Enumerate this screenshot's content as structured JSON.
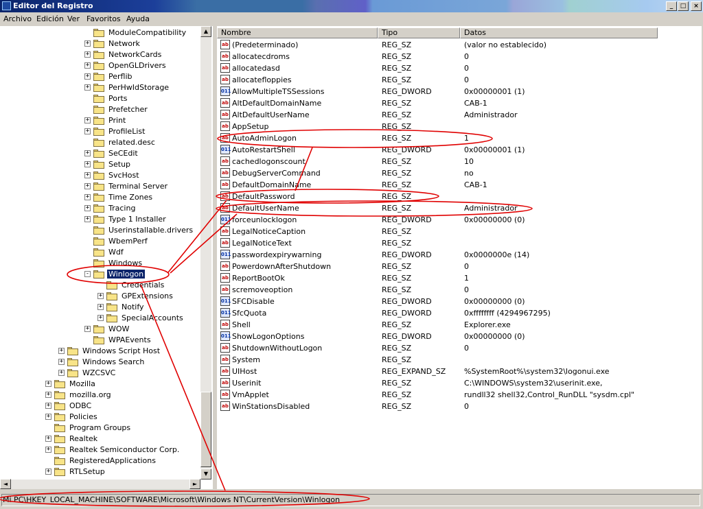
{
  "window": {
    "title": "Editor del Registro",
    "buttons": [
      "_",
      "□",
      "×"
    ]
  },
  "menu": [
    "Archivo",
    "Edición",
    "Ver",
    "Favoritos",
    "Ayuda"
  ],
  "tree": [
    {
      "label": "ModuleCompatibility",
      "level": 3,
      "exp": ""
    },
    {
      "label": "Network",
      "level": 3,
      "exp": "+"
    },
    {
      "label": "NetworkCards",
      "level": 3,
      "exp": "+"
    },
    {
      "label": "OpenGLDrivers",
      "level": 3,
      "exp": "+"
    },
    {
      "label": "Perflib",
      "level": 3,
      "exp": "+"
    },
    {
      "label": "PerHwIdStorage",
      "level": 3,
      "exp": "+"
    },
    {
      "label": "Ports",
      "level": 3,
      "exp": ""
    },
    {
      "label": "Prefetcher",
      "level": 3,
      "exp": ""
    },
    {
      "label": "Print",
      "level": 3,
      "exp": "+"
    },
    {
      "label": "ProfileList",
      "level": 3,
      "exp": "+"
    },
    {
      "label": "related.desc",
      "level": 3,
      "exp": ""
    },
    {
      "label": "SeCEdit",
      "level": 3,
      "exp": "+"
    },
    {
      "label": "Setup",
      "level": 3,
      "exp": "+"
    },
    {
      "label": "SvcHost",
      "level": 3,
      "exp": "+"
    },
    {
      "label": "Terminal Server",
      "level": 3,
      "exp": "+"
    },
    {
      "label": "Time Zones",
      "level": 3,
      "exp": "+"
    },
    {
      "label": "Tracing",
      "level": 3,
      "exp": "+"
    },
    {
      "label": "Type 1 Installer",
      "level": 3,
      "exp": "+"
    },
    {
      "label": "Userinstallable.drivers",
      "level": 3,
      "exp": ""
    },
    {
      "label": "WbemPerf",
      "level": 3,
      "exp": ""
    },
    {
      "label": "Wdf",
      "level": 3,
      "exp": ""
    },
    {
      "label": "Windows",
      "level": 3,
      "exp": ""
    },
    {
      "label": "Winlogon",
      "level": 3,
      "exp": "-",
      "selected": true
    },
    {
      "label": "Credentials",
      "level": 4,
      "exp": ""
    },
    {
      "label": "GPExtensions",
      "level": 4,
      "exp": "+"
    },
    {
      "label": "Notify",
      "level": 4,
      "exp": "+"
    },
    {
      "label": "SpecialAccounts",
      "level": 4,
      "exp": "+"
    },
    {
      "label": "WOW",
      "level": 3,
      "exp": "+"
    },
    {
      "label": "WPAEvents",
      "level": 3,
      "exp": ""
    },
    {
      "label": "Windows Script Host",
      "level": 2,
      "exp": "+"
    },
    {
      "label": "Windows Search",
      "level": 2,
      "exp": "+"
    },
    {
      "label": "WZCSVC",
      "level": 2,
      "exp": "+"
    },
    {
      "label": "Mozilla",
      "level": 1,
      "exp": "+"
    },
    {
      "label": "mozilla.org",
      "level": 1,
      "exp": "+"
    },
    {
      "label": "ODBC",
      "level": 1,
      "exp": "+"
    },
    {
      "label": "Policies",
      "level": 1,
      "exp": "+"
    },
    {
      "label": "Program Groups",
      "level": 1,
      "exp": ""
    },
    {
      "label": "Realtek",
      "level": 1,
      "exp": "+"
    },
    {
      "label": "Realtek Semiconductor Corp.",
      "level": 1,
      "exp": "+"
    },
    {
      "label": "RegisteredApplications",
      "level": 1,
      "exp": ""
    },
    {
      "label": "RTLSetup",
      "level": 1,
      "exp": "+"
    }
  ],
  "columns": [
    "Nombre",
    "Tipo",
    "Datos"
  ],
  "values": [
    {
      "name": "(Predeterminado)",
      "type": "REG_SZ",
      "data": "(valor no establecido)",
      "icon": "ab"
    },
    {
      "name": "allocatecdroms",
      "type": "REG_SZ",
      "data": "0",
      "icon": "ab"
    },
    {
      "name": "allocatedasd",
      "type": "REG_SZ",
      "data": "0",
      "icon": "ab"
    },
    {
      "name": "allocatefloppies",
      "type": "REG_SZ",
      "data": "0",
      "icon": "ab"
    },
    {
      "name": "AllowMultipleTSSessions",
      "type": "REG_DWORD",
      "data": "0x00000001 (1)",
      "icon": "bin"
    },
    {
      "name": "AltDefaultDomainName",
      "type": "REG_SZ",
      "data": "CAB-1",
      "icon": "ab"
    },
    {
      "name": "AltDefaultUserName",
      "type": "REG_SZ",
      "data": "Administrador",
      "icon": "ab"
    },
    {
      "name": "AppSetup",
      "type": "REG_SZ",
      "data": "",
      "icon": "ab"
    },
    {
      "name": "AutoAdminLogon",
      "type": "REG_SZ",
      "data": "1",
      "icon": "ab"
    },
    {
      "name": "AutoRestartShell",
      "type": "REG_DWORD",
      "data": "0x00000001 (1)",
      "icon": "bin"
    },
    {
      "name": "cachedlogonscount",
      "type": "REG_SZ",
      "data": "10",
      "icon": "ab"
    },
    {
      "name": "DebugServerCommand",
      "type": "REG_SZ",
      "data": "no",
      "icon": "ab"
    },
    {
      "name": "DefaultDomainName",
      "type": "REG_SZ",
      "data": "CAB-1",
      "icon": "ab"
    },
    {
      "name": "DefaultPassword",
      "type": "REG_SZ",
      "data": "",
      "icon": "ab"
    },
    {
      "name": "DefaultUserName",
      "type": "REG_SZ",
      "data": "Administrador",
      "icon": "ab"
    },
    {
      "name": "forceunlocklogon",
      "type": "REG_DWORD",
      "data": "0x00000000 (0)",
      "icon": "bin"
    },
    {
      "name": "LegalNoticeCaption",
      "type": "REG_SZ",
      "data": "",
      "icon": "ab"
    },
    {
      "name": "LegalNoticeText",
      "type": "REG_SZ",
      "data": "",
      "icon": "ab"
    },
    {
      "name": "passwordexpirywarning",
      "type": "REG_DWORD",
      "data": "0x0000000e (14)",
      "icon": "bin"
    },
    {
      "name": "PowerdownAfterShutdown",
      "type": "REG_SZ",
      "data": "0",
      "icon": "ab"
    },
    {
      "name": "ReportBootOk",
      "type": "REG_SZ",
      "data": "1",
      "icon": "ab"
    },
    {
      "name": "scremoveoption",
      "type": "REG_SZ",
      "data": "0",
      "icon": "ab"
    },
    {
      "name": "SFCDisable",
      "type": "REG_DWORD",
      "data": "0x00000000 (0)",
      "icon": "bin"
    },
    {
      "name": "SfcQuota",
      "type": "REG_DWORD",
      "data": "0xffffffff (4294967295)",
      "icon": "bin"
    },
    {
      "name": "Shell",
      "type": "REG_SZ",
      "data": "Explorer.exe",
      "icon": "ab"
    },
    {
      "name": "ShowLogonOptions",
      "type": "REG_DWORD",
      "data": "0x00000000 (0)",
      "icon": "bin"
    },
    {
      "name": "ShutdownWithoutLogon",
      "type": "REG_SZ",
      "data": "0",
      "icon": "ab"
    },
    {
      "name": "System",
      "type": "REG_SZ",
      "data": "",
      "icon": "ab"
    },
    {
      "name": "UIHost",
      "type": "REG_EXPAND_SZ",
      "data": "%SystemRoot%\\system32\\logonui.exe",
      "icon": "ab"
    },
    {
      "name": "Userinit",
      "type": "REG_SZ",
      "data": "C:\\WINDOWS\\system32\\userinit.exe,",
      "icon": "ab"
    },
    {
      "name": "VmApplet",
      "type": "REG_SZ",
      "data": "rundll32 shell32,Control_RunDLL \"sysdm.cpl\"",
      "icon": "ab"
    },
    {
      "name": "WinStationsDisabled",
      "type": "REG_SZ",
      "data": "0",
      "icon": "ab"
    }
  ],
  "statusbar": "Mi PC\\HKEY_LOCAL_MACHINE\\SOFTWARE\\Microsoft\\Windows NT\\CurrentVersion\\Winlogon",
  "annotation_color": "#e00000"
}
